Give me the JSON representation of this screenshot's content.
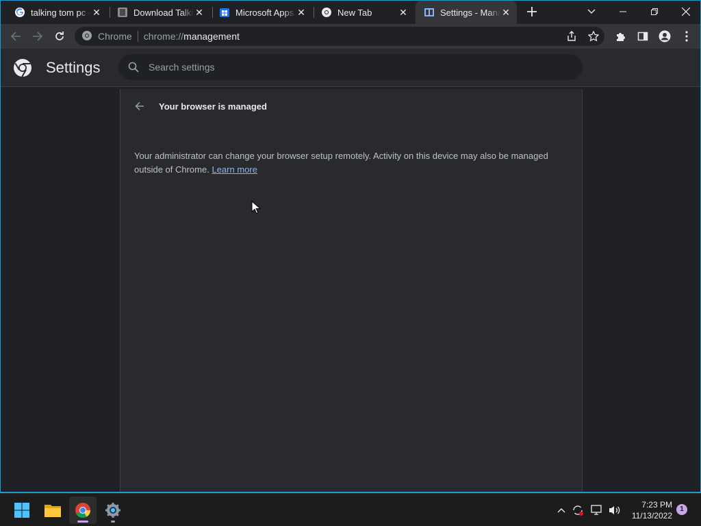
{
  "browser": {
    "tabs": [
      {
        "title": "talking tom pc -",
        "favicon": "google-icon",
        "active": false
      },
      {
        "title": "Download Talkin",
        "favicon": "download-site-icon",
        "active": false
      },
      {
        "title": "Microsoft Apps",
        "favicon": "microsoft-store-icon",
        "active": false
      },
      {
        "title": "New Tab",
        "favicon": "chrome-icon",
        "active": false
      },
      {
        "title": "Settings - Mana",
        "favicon": "settings-page-icon",
        "active": true
      }
    ],
    "omnibox": {
      "site_label": "Chrome",
      "url_scheme": "chrome://",
      "url_host": "management"
    }
  },
  "settings": {
    "title": "Settings",
    "search_placeholder": "Search settings",
    "page_title": "Your browser is managed",
    "description": "Your administrator can change your browser setup remotely. Activity on this device may also be managed outside of Chrome.",
    "learn_more": "Learn more"
  },
  "taskbar": {
    "apps": [
      "start-icon",
      "file-explorer-icon",
      "chrome-icon",
      "settings-app-icon"
    ],
    "time": "7:23 PM",
    "date": "11/13/2022",
    "notification_count": "1"
  },
  "colors": {
    "accent": "#8ab4f8",
    "window_border": "#1f9bd1",
    "background": "#202124",
    "card": "#292a2d"
  }
}
